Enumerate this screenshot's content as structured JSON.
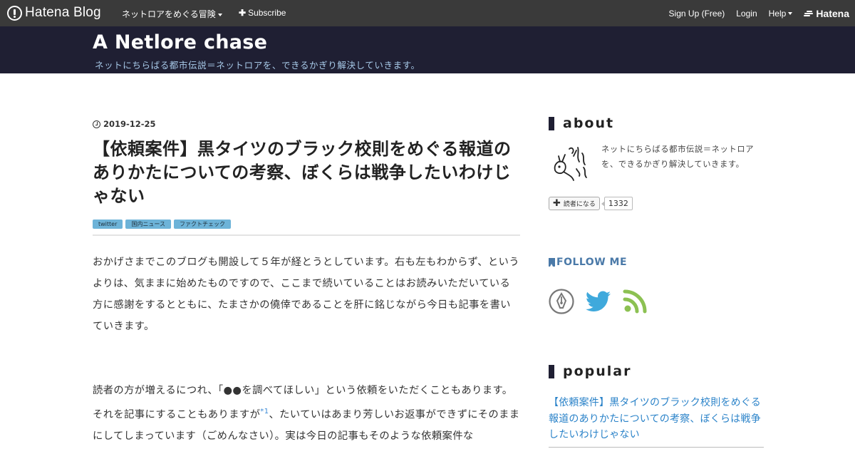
{
  "globalbar": {
    "logo_text": "Hatena Blog",
    "blog_menu": "ネットロアをめぐる冒険",
    "subscribe": "Subscribe",
    "signup": "Sign Up (Free)",
    "login": "Login",
    "help": "Help",
    "hatena": "Hatena"
  },
  "header": {
    "title": "A Netlore chase",
    "description": "ネットにちらばる都市伝説＝ネットロアを、できるかぎり解決していきます。"
  },
  "article": {
    "date": "2019-12-25",
    "title": "【依頼案件】黒タイツのブラック校則をめぐる報道のありかたについての考察、ぼくらは戦争したいわけじゃない",
    "categories": [
      "twitter",
      "国内ニュース",
      "ファクトチェック"
    ],
    "paragraph1": "おかげさまでこのブログも開設して５年が経とうとしています。右も左もわからず、というよりは、気ままに始めたものですので、ここまで続いていることはお読みいただいている方に感謝をするとともに、たまさかの僥倖であることを肝に銘じながら今日も記事を書いていきます。",
    "paragraph2_a": "読者の方が増えるにつれ、「●●を調べてほしい」という依頼をいただくこともあります。それを記事にすることもありますが",
    "footnote": "*1",
    "paragraph2_b": "、たいていはあまり芳しいお返事ができずにそのままにしてしまっています（ごめんなさい）。実は今日の記事もそのような依頼案件な"
  },
  "sidebar": {
    "about_title": "about",
    "about_text": "ネットにちらばる都市伝説＝ネットロアを、できるかぎり解決していきます。",
    "subscribe_label": "読者になる",
    "subscriber_count": "1332",
    "follow_title": "FOLLOW ME",
    "follow_icons": [
      "hatena-pen-icon",
      "twitter-icon",
      "rss-icon"
    ],
    "popular_title": "popular",
    "popular_items": [
      "【依頼案件】黒タイツのブラック校則をめぐる報道のありかたについての考察、ぼくらは戦争したいわけじゃない"
    ]
  },
  "colors": {
    "globalbar_bg": "#3a3a3a",
    "header_bg": "#1f1f33",
    "header_desc": "#a7c9e8",
    "category_bg": "#6db3d8",
    "link": "#2b83c9",
    "twitter": "#3fa9dc",
    "rss": "#8cc152"
  }
}
